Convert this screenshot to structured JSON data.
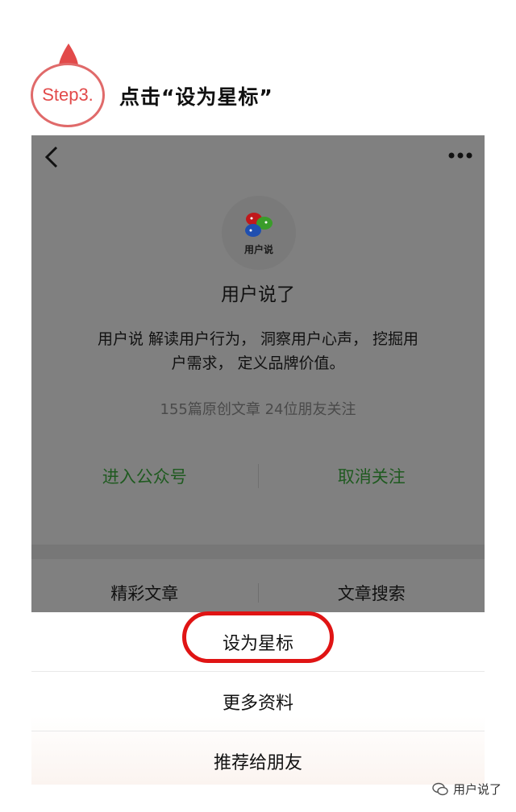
{
  "step": {
    "badge": "Step3.",
    "title": "点击“设为星标”"
  },
  "profile": {
    "logo_caption": "用户说",
    "name": "用户说了",
    "description_line1": "用户说 解读用户行为， 洞察用户心声， 挖掘用",
    "description_line2": "户需求， 定义品牌价值。",
    "stats": "155篇原创文章  24位朋友关注",
    "enter_button": "进入公众号",
    "unfollow_button": "取消关注",
    "tabs": [
      "精彩文章",
      "文章搜索"
    ]
  },
  "sheet": {
    "items": [
      "设为星标",
      "更多资料",
      "推荐给朋友"
    ]
  },
  "watermark": "用户说了",
  "colors": {
    "accent_red": "#e01414",
    "step_red": "#e24a4a",
    "action_green": "#1f5a20",
    "dim_overlay": "#808080"
  },
  "icons": [
    "drop-icon",
    "back-arrow-icon",
    "more-dots-icon",
    "logo-speech-bubbles",
    "wechat-icon"
  ]
}
